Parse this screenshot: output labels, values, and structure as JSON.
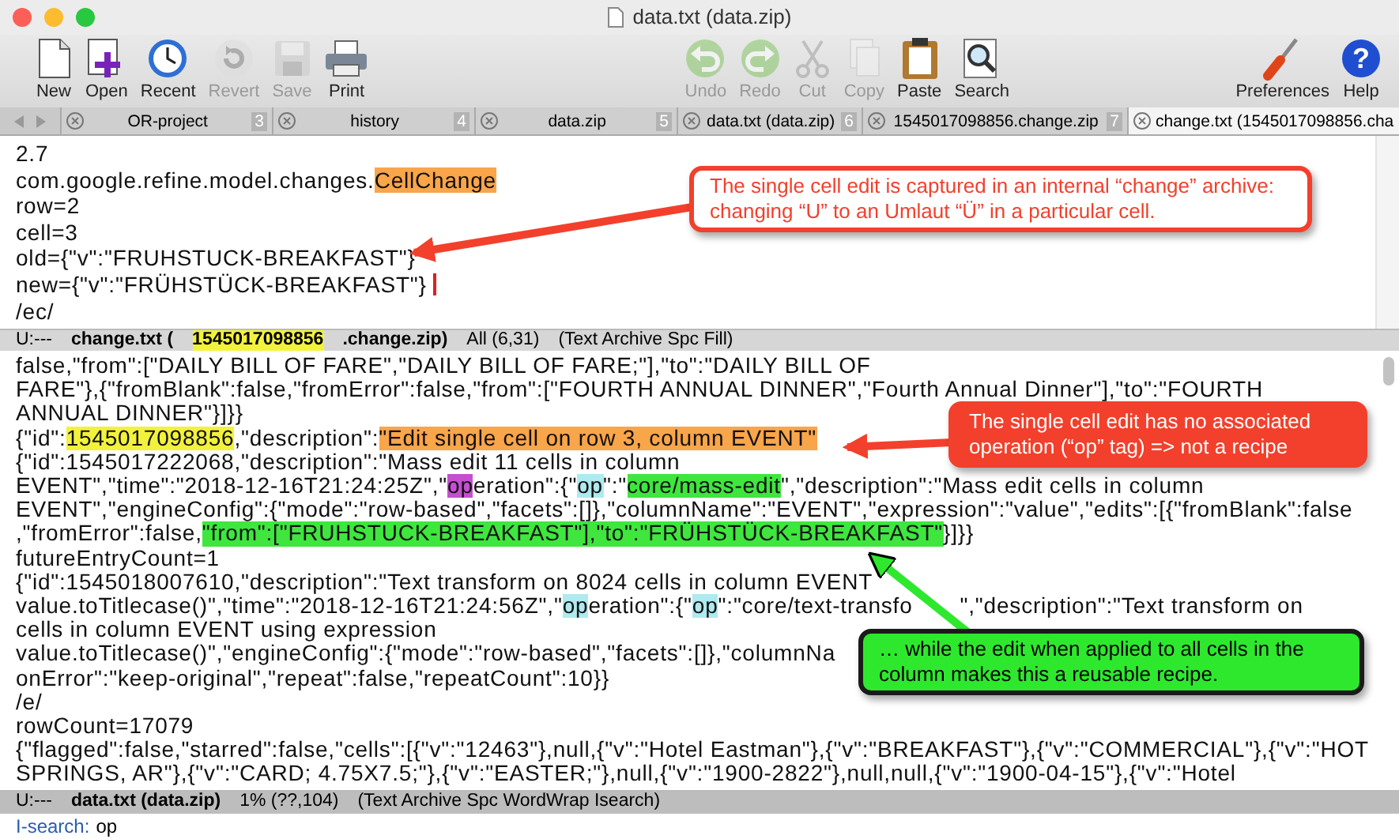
{
  "window": {
    "title": "data.txt (data.zip)"
  },
  "toolbar": {
    "left": [
      {
        "label": "New",
        "kind": "new",
        "disabled": false
      },
      {
        "label": "Open",
        "kind": "open",
        "disabled": false
      },
      {
        "label": "Recent",
        "kind": "recent",
        "disabled": false
      },
      {
        "label": "Revert",
        "kind": "revert",
        "disabled": true
      },
      {
        "label": "Save",
        "kind": "save",
        "disabled": true
      },
      {
        "label": "Print",
        "kind": "print",
        "disabled": false
      }
    ],
    "center": [
      {
        "label": "Undo",
        "kind": "undo",
        "disabled": true
      },
      {
        "label": "Redo",
        "kind": "redo",
        "disabled": true
      },
      {
        "label": "Cut",
        "kind": "cut",
        "disabled": true
      },
      {
        "label": "Copy",
        "kind": "copy",
        "disabled": true
      },
      {
        "label": "Paste",
        "kind": "paste",
        "disabled": false
      },
      {
        "label": "Search",
        "kind": "search",
        "disabled": false
      }
    ],
    "right": [
      {
        "label": "Preferences",
        "kind": "preferences",
        "disabled": false
      },
      {
        "label": "Help",
        "kind": "help",
        "disabled": false,
        "glyph": "?"
      }
    ]
  },
  "tabs": [
    {
      "label": "OR-project",
      "number": "3",
      "selected": false
    },
    {
      "label": "history",
      "number": "4",
      "selected": false
    },
    {
      "label": "data.zip",
      "number": "5",
      "selected": false
    },
    {
      "label": "data.txt (data.zip)",
      "number": "6",
      "selected": false
    },
    {
      "label": "1545017098856.change.zip",
      "number": "7",
      "selected": false
    },
    {
      "label": "change.txt (1545017098856.cha",
      "selected": true
    }
  ],
  "top_pane": {
    "lines": [
      {
        "cursor": false,
        "segments": [
          "2.7"
        ]
      },
      {
        "cursor": false,
        "segments": [
          "com.google.refine.model.changes.",
          {
            "text": "CellChange",
            "color": "#f9a54a"
          }
        ]
      },
      {
        "cursor": false,
        "segments": [
          "row=2"
        ]
      },
      {
        "cursor": false,
        "segments": [
          "cell=3"
        ]
      },
      {
        "cursor": false,
        "segments": [
          "old={\"v\":\"FRUHSTUCK-BREAKFAST\"}"
        ]
      },
      {
        "cursor": true,
        "segments": [
          "new={\"v\":\"FRÜHSTÜCK-BREAKFAST\"}"
        ]
      },
      {
        "cursor": false,
        "segments": [
          "/ec/"
        ]
      }
    ],
    "mode_line": [
      {
        "text": "U:---",
        "bold": false
      },
      {
        "text": "change.txt (",
        "bold": true
      },
      {
        "text": "1545017098856",
        "bold": true,
        "color": "#f2f23c"
      },
      {
        "text": ".change.zip)",
        "bold": true
      },
      {
        "text": "All (6,31)",
        "bold": false
      },
      {
        "text": "(Text Archive Spc Fill)",
        "bold": false
      }
    ]
  },
  "bottom_pane": {
    "lines": [
      [
        "false,\"from\":[\"DAILY BILL OF FARE\",\"DAILY BILL OF FARE;\"],\"to\":\"DAILY BILL OF"
      ],
      [
        "FARE\"},{\"fromBlank\":false,\"fromError\":false,\"from\":[\"FOURTH ANNUAL DINNER\",\"Fourth Annual Dinner\"],\"to\":\"FOURTH"
      ],
      [
        "ANNUAL DINNER\"}]}}"
      ],
      [
        "{\"id\":",
        {
          "text": "1545017098856",
          "color": "#f2f23c"
        },
        ",\"description\":",
        {
          "text": "\"Edit single cell on row 3, column EVENT\"",
          "color": "#f9a54a"
        }
      ],
      [
        "{\"id\":1545017222068,\"description\":\"Mass edit 11 cells in column"
      ],
      [
        "EVENT\",\"time\":\"2018-12-16T21:24:25Z\",\"",
        {
          "text": "op",
          "color": "#c44fd0"
        },
        "eration\":{\"",
        {
          "text": "op",
          "color": "#aeeaf0"
        },
        "\":\"",
        {
          "text": "core/mass-edit",
          "color": "#3ee63e"
        },
        "\",\"description\":\"Mass edit cells in column"
      ],
      [
        "EVENT\",\"engineConfig\":{\"mode\":\"row-based\",\"facets\":[]},\"columnName\":\"EVENT\",\"expression\":\"value\",\"edits\":[{\"fromBlank\":false"
      ],
      [
        ",\"fromError\":false,",
        {
          "text": "\"from\":[\"FRUHSTUCK-BREAKFAST\"],\"to\":\"FRÜHSTÜCK-BREAKFAST\"",
          "color": "#3ee63e"
        },
        "}]}}"
      ],
      [
        "futureEntryCount=1"
      ],
      [
        "{\"id\":1545018007610,\"description\":\"Text transform on 8024 cells in column EVENT"
      ],
      [
        "value.toTitlecase()\",\"time\":\"2018-12-16T21:24:56Z\",\"",
        {
          "text": "op",
          "color": "#aeeaf0"
        },
        "eration\":{\"",
        {
          "text": "op",
          "color": "#aeeaf0"
        },
        "\":\"core/text-transfo",
        "\",\"description\":\"Text transform on"
      ],
      [
        "cells in column EVENT using expression"
      ],
      [
        "value.toTitlecase()\",\"engineConfig\":{\"mode\":\"row-based\",\"facets\":[]},\"columnNa"
      ],
      [
        "onError\":\"keep-original\",\"repeat\":false,\"repeatCount\":10}}"
      ],
      [
        "/e/"
      ],
      [
        "rowCount=17079"
      ],
      [
        "{\"flagged\":false,\"starred\":false,\"cells\":[{\"v\":\"12463\"},null,{\"v\":\"Hotel Eastman\"},{\"v\":\"BREAKFAST\"},{\"v\":\"COMMERCIAL\"},{\"v\":\"HOT"
      ],
      [
        "SPRINGS, AR\"},{\"v\":\"CARD; 4.75X7.5;\"},{\"v\":\"EASTER;\"},null,{\"v\":\"1900-2822\"},null,null,{\"v\":\"1900-04-15\"},{\"v\":\"Hotel"
      ]
    ],
    "mode_line": [
      {
        "text": "U:---",
        "bold": false
      },
      {
        "text": "data.txt (data.zip)",
        "bold": true
      },
      {
        "text": "1% (??,104)",
        "bold": false
      },
      {
        "text": "(Text Archive Spc WordWrap Isearch)",
        "bold": false
      }
    ]
  },
  "minibuffer": {
    "prompt": "I-search:",
    "value": "op"
  },
  "callouts": [
    {
      "kind": "outline",
      "color": "#f2402c",
      "text": "The single cell edit is captured in an internal “change” archive: changing “U” to an Umlaut “Ü” in a particular cell."
    },
    {
      "kind": "filled",
      "color": "#f2402c",
      "text": "The single cell edit has no associated operation (“op” tag) => not a recipe"
    },
    {
      "kind": "filled",
      "color": "#2ee82e",
      "text": "… while the edit when applied to all cells in the column makes this a reusable recipe."
    }
  ]
}
